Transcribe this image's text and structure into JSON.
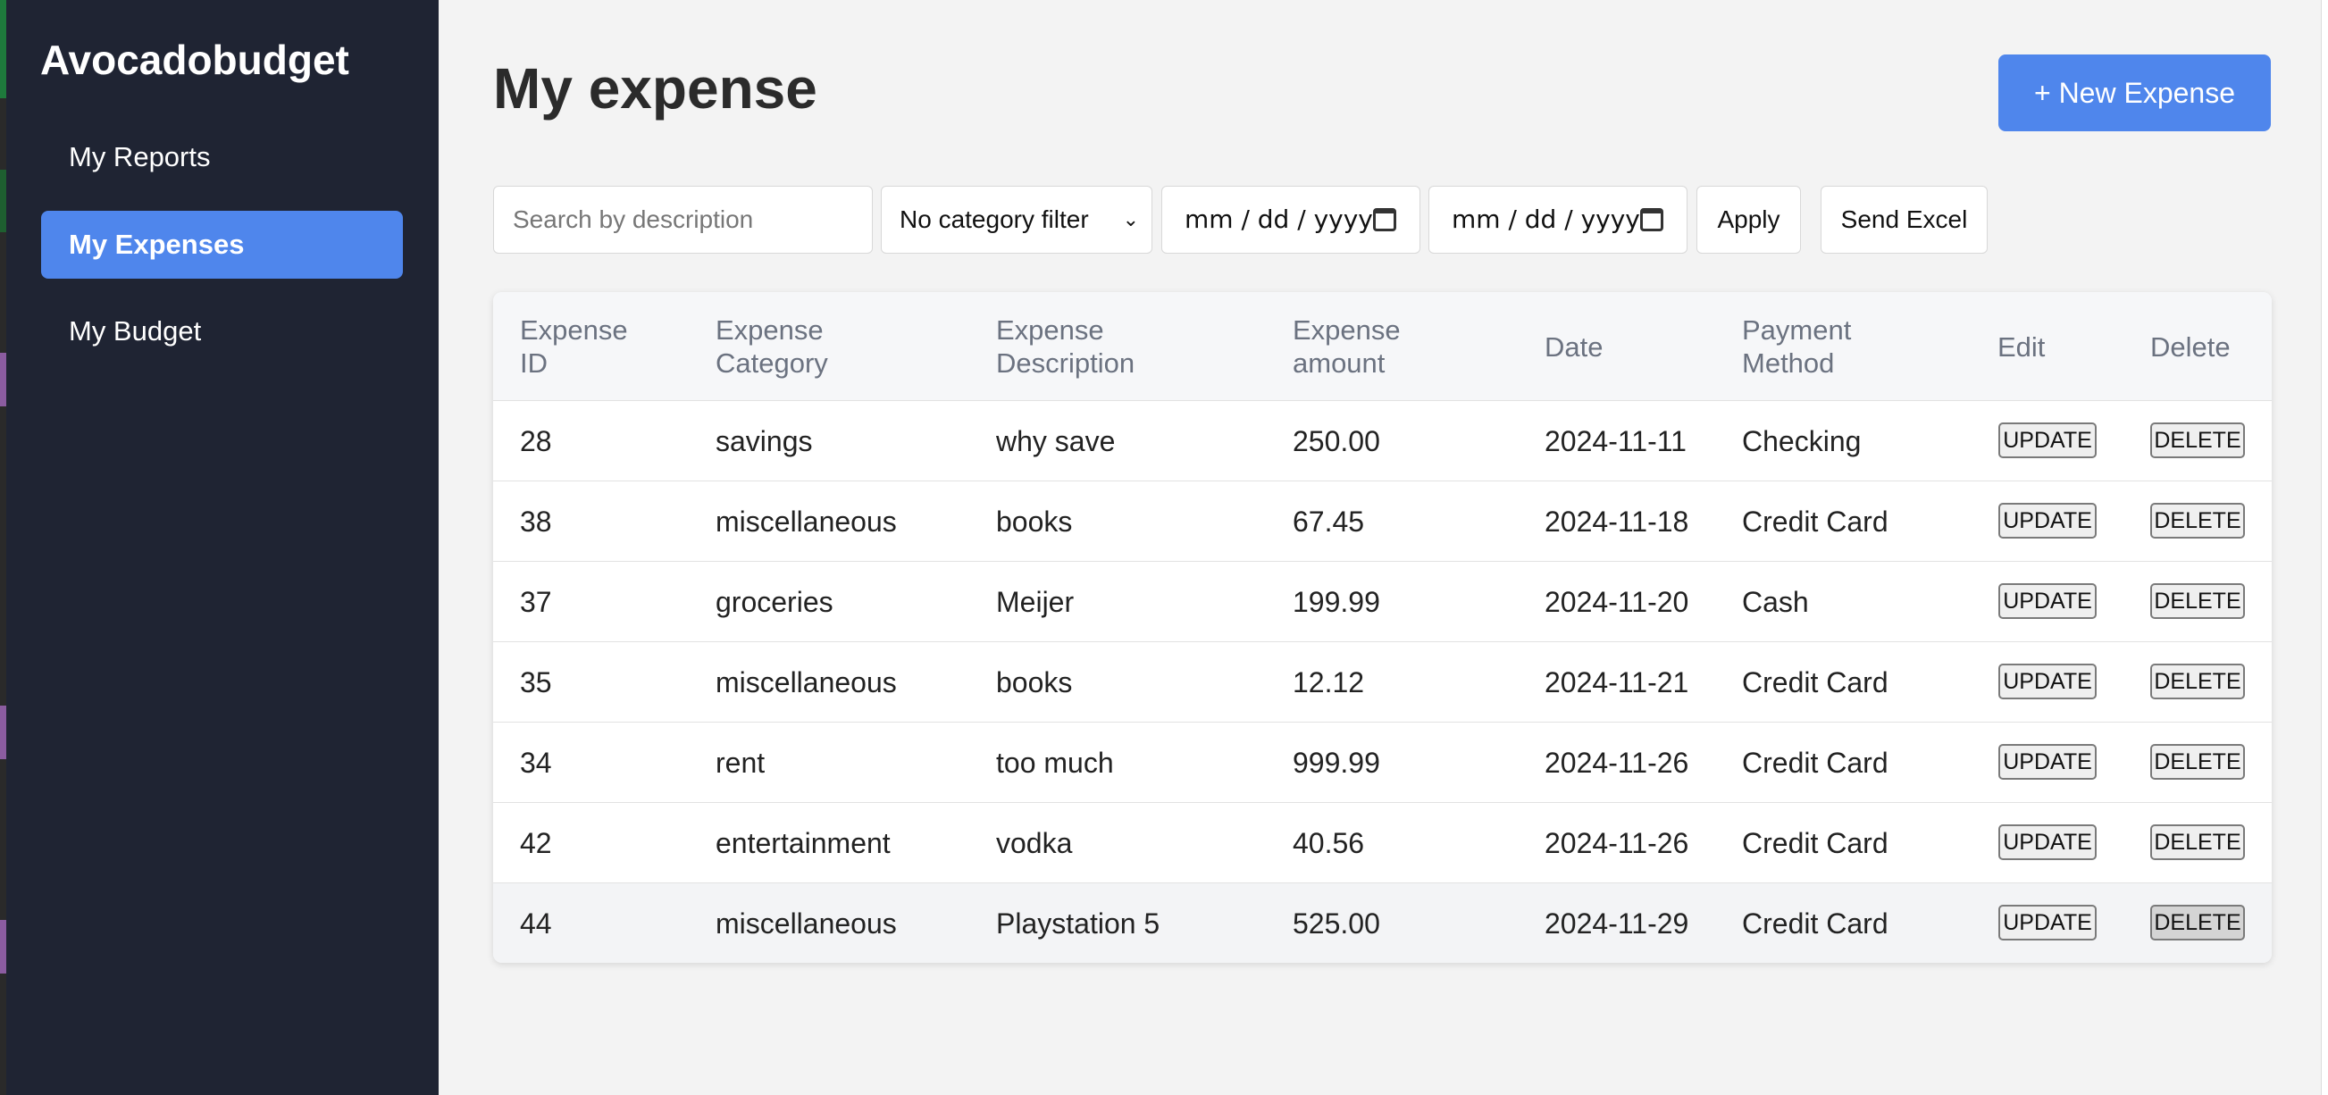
{
  "app": {
    "brand": "Avocadobudget"
  },
  "sidebar": {
    "items": [
      {
        "label": "My Reports",
        "active": false
      },
      {
        "label": "My Expenses",
        "active": true
      },
      {
        "label": "My Budget",
        "active": false
      }
    ]
  },
  "main": {
    "title": "My expense",
    "new_button": "+ New Expense"
  },
  "filters": {
    "search_placeholder": "Search by description",
    "category_selected": "No category filter",
    "start_date_placeholder": "mm / dd / yyyy",
    "end_date_placeholder": "mm / dd / yyyy",
    "apply_label": "Apply",
    "send_excel_label": "Send Excel"
  },
  "table": {
    "headers": [
      [
        "Expense",
        "ID"
      ],
      [
        "Expense",
        "Category"
      ],
      [
        "Expense",
        "Description"
      ],
      [
        "Expense",
        "amount"
      ],
      [
        "Date"
      ],
      [
        "Payment",
        "Method"
      ],
      [
        "Edit"
      ],
      [
        "Delete"
      ]
    ],
    "update_label": "UPDATE",
    "delete_label": "DELETE",
    "rows": [
      {
        "id": "28",
        "category": "savings",
        "description": "why save",
        "amount": "250.00",
        "date": "2024-11-11",
        "method": "Checking"
      },
      {
        "id": "38",
        "category": "miscellaneous",
        "description": "books",
        "amount": "67.45",
        "date": "2024-11-18",
        "method": "Credit Card"
      },
      {
        "id": "37",
        "category": "groceries",
        "description": "Meijer",
        "amount": "199.99",
        "date": "2024-11-20",
        "method": "Cash"
      },
      {
        "id": "35",
        "category": "miscellaneous",
        "description": "books",
        "amount": "12.12",
        "date": "2024-11-21",
        "method": "Credit Card"
      },
      {
        "id": "34",
        "category": "rent",
        "description": "too much",
        "amount": "999.99",
        "date": "2024-11-26",
        "method": "Credit Card"
      },
      {
        "id": "42",
        "category": "entertainment",
        "description": "vodka",
        "amount": "40.56",
        "date": "2024-11-26",
        "method": "Credit Card"
      },
      {
        "id": "44",
        "category": "miscellaneous",
        "description": "Playstation 5",
        "amount": "525.00",
        "date": "2024-11-29",
        "method": "Credit Card"
      }
    ]
  },
  "colors": {
    "sidebar_bg": "#1f2433",
    "accent": "#4f86ec",
    "page_bg": "#f3f3f3"
  }
}
